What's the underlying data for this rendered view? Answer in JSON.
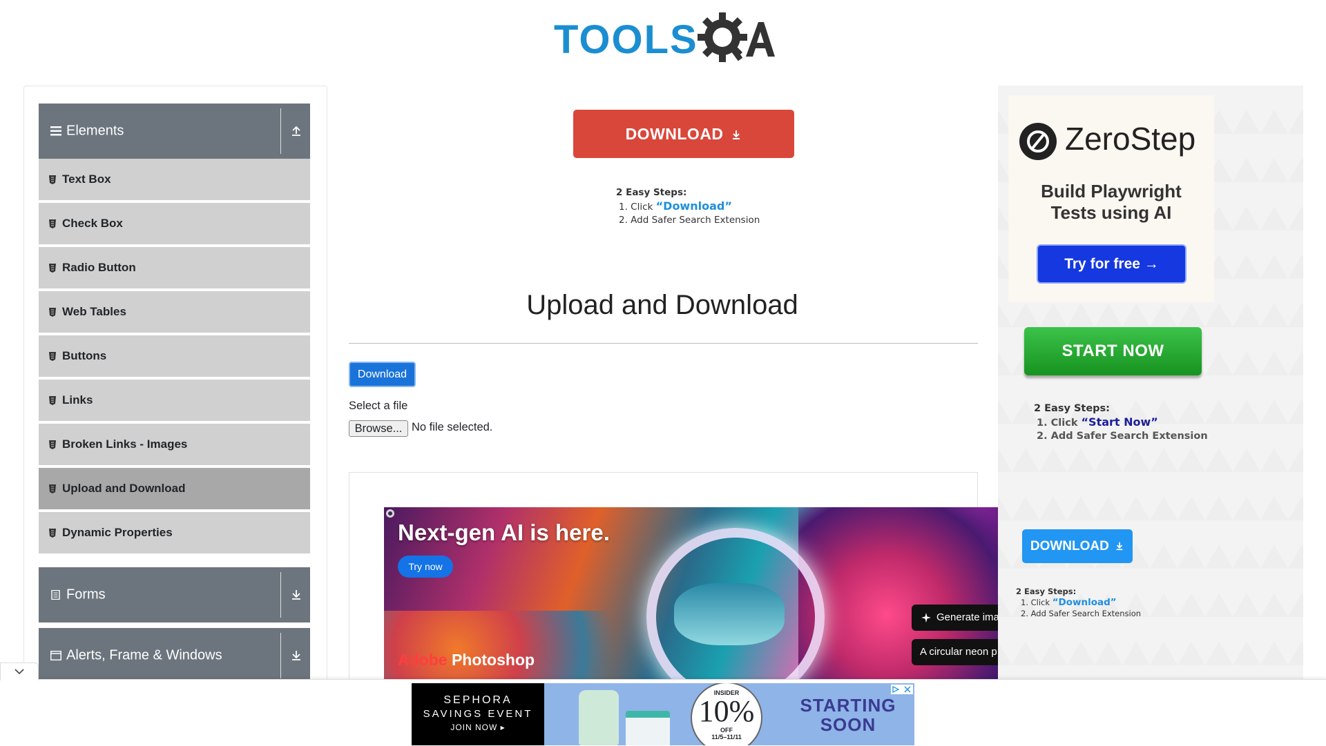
{
  "logo": {
    "text": "TOOLS",
    "suffix": "QA"
  },
  "sidebar": {
    "groups": [
      {
        "label": "Elements"
      },
      {
        "label": "Forms"
      },
      {
        "label": "Alerts, Frame & Windows"
      }
    ],
    "items": [
      {
        "label": "Text Box"
      },
      {
        "label": "Check Box"
      },
      {
        "label": "Radio Button"
      },
      {
        "label": "Web Tables"
      },
      {
        "label": "Buttons"
      },
      {
        "label": "Links"
      },
      {
        "label": "Broken Links - Images"
      },
      {
        "label": "Upload and Download"
      },
      {
        "label": "Dynamic Properties"
      }
    ]
  },
  "ad_top": {
    "button": "DOWNLOAD",
    "steps_heading": "2 Easy Steps:",
    "step1_prefix": "1. Click",
    "step1_link": "“Download”",
    "step2": "2. Add Safer Search Extension"
  },
  "main": {
    "title": "Upload and Download",
    "download_button": "Download",
    "select_label": "Select a file",
    "browse_button": "Browse...",
    "no_file": "No file selected."
  },
  "photoshop_ad": {
    "headline": "Next-gen AI is here.",
    "cta": "Try now",
    "brand_a": "Adobe",
    "brand_rest": " Photoshop",
    "pill1": "Generate ima",
    "pill2": "A circular neon p"
  },
  "right_rail": {
    "zerostep_name": "ZeroStep",
    "zerostep_tagline_1": "Build Playwright",
    "zerostep_tagline_2": "Tests using AI",
    "zerostep_cta": "Try for free →",
    "start_now": "START NOW",
    "steps2_heading": "2 Easy Steps:",
    "steps2_step1_prefix": "1. Click",
    "steps2_step1_link": "“Start Now”",
    "steps2_step2": "2. Add Safer Search Extension",
    "download_button": "DOWNLOAD",
    "steps3_heading": "2 Easy Steps:",
    "steps3_step1_prefix": "1. Click",
    "steps3_step1_link": "“Download”",
    "steps3_step2": "2. Add Safer Search Extension"
  },
  "bottom_ad": {
    "brand": "SEPHORA",
    "event": "SAVINGS EVENT",
    "cta": "JOIN NOW ▸",
    "insider": "INSIDER",
    "percent": "10%",
    "off": "OFF",
    "dates": "11/5–11/11",
    "starting": "STARTING",
    "soon": "SOON"
  },
  "colors": {
    "sidebar_header": "#6c757d",
    "sidebar_item": "#d0d0d0",
    "sidebar_active": "#a8a8a8",
    "primary_button": "#1a73d9",
    "ad_red": "#d9473b",
    "start_green": "#17931f",
    "zerostep_blue": "#1638e0"
  }
}
